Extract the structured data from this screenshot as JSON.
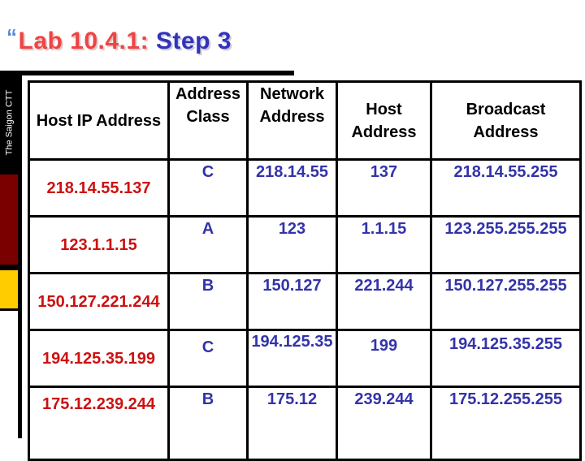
{
  "title": {
    "bullet": "“",
    "part1": "Lab 10.4.1:",
    "part2": "Step 3"
  },
  "sidebar": {
    "text": "The Saigon CTT",
    "colors": {
      "black": "#000000",
      "dark_red": "#7a0000",
      "yellow": "#ffcc00"
    }
  },
  "colors": {
    "ip_text": "#cc1111",
    "answer_text": "#3333aa",
    "title_red": "#ee4444",
    "title_blue": "#3333bb"
  },
  "table": {
    "headers": [
      "Host IP Address",
      "Address Class",
      "Network Address",
      "Host Address",
      "Broadcast Address"
    ],
    "rows": [
      {
        "host_ip": "218.14.55.137",
        "class": "C",
        "network": "218.14.55",
        "host": "137",
        "broadcast": "218.14.55.255"
      },
      {
        "host_ip": "123.1.1.15",
        "class": "A",
        "network": "123",
        "host": "1.1.15",
        "broadcast": "123.255.255.255"
      },
      {
        "host_ip": "150.127.221.244",
        "class": "B",
        "network": "150.127",
        "host": "221.244",
        "broadcast": "150.127.255.255"
      },
      {
        "host_ip": "194.125.35.199",
        "class": "C",
        "network": "194.125.35",
        "host": "199",
        "broadcast": "194.125.35.255"
      },
      {
        "host_ip": "175.12.239.244",
        "class": "B",
        "network": "175.12",
        "host": "239.244",
        "broadcast": "175.12.255.255"
      }
    ]
  }
}
